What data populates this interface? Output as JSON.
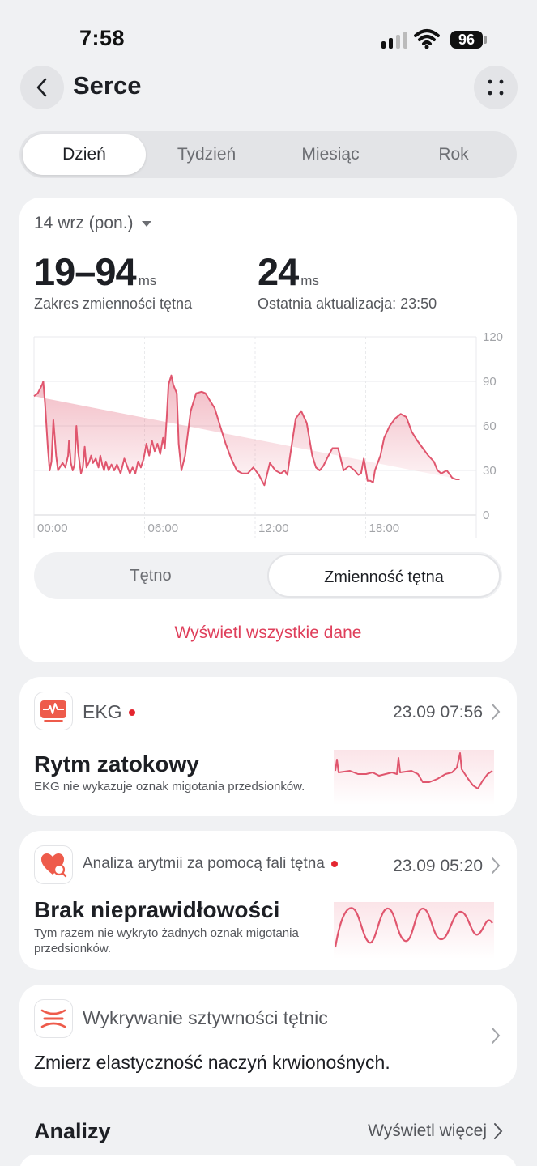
{
  "status_bar": {
    "time": "7:58",
    "battery": "96"
  },
  "header": {
    "title": "Serce"
  },
  "period_tabs": [
    {
      "label": "Dzień",
      "active": true
    },
    {
      "label": "Tydzień",
      "active": false
    },
    {
      "label": "Miesiąc",
      "active": false
    },
    {
      "label": "Rok",
      "active": false
    }
  ],
  "summary": {
    "date": "14 wrz (pon.)",
    "range_value": "19–94",
    "range_unit": "ms",
    "range_label": "Zakres zmienności tętna",
    "last_value": "24",
    "last_unit": "ms",
    "last_label": "Ostatnia aktualizacja: 23:50"
  },
  "chart_data": {
    "type": "area",
    "x_ticks": [
      "00:00",
      "06:00",
      "12:00",
      "18:00"
    ],
    "y_ticks": [
      120,
      90,
      60,
      30,
      0
    ],
    "ylim": [
      0,
      120
    ],
    "xlim": [
      0,
      24
    ],
    "series_color": "#e0566e",
    "x": [
      0.0,
      0.2,
      0.45,
      0.5,
      0.6,
      0.75,
      0.85,
      0.95,
      1.05,
      1.2,
      1.3,
      1.4,
      1.55,
      1.7,
      1.85,
      1.9,
      2.0,
      2.1,
      2.2,
      2.3,
      2.4,
      2.55,
      2.65,
      2.75,
      2.85,
      3.0,
      3.1,
      3.2,
      3.35,
      3.5,
      3.6,
      3.7,
      3.8,
      3.9,
      4.05,
      4.2,
      4.35,
      4.5,
      4.7,
      4.9,
      5.05,
      5.2,
      5.35,
      5.5,
      5.65,
      5.8,
      5.95,
      6.1,
      6.25,
      6.4,
      6.55,
      6.7,
      6.85,
      7.0,
      7.1,
      7.2,
      7.3,
      7.45,
      7.55,
      7.65,
      7.75,
      7.85,
      8.0,
      8.2,
      8.5,
      8.8,
      9.1,
      9.3,
      9.5,
      9.8,
      10.1,
      10.4,
      10.7,
      11.0,
      11.3,
      11.6,
      11.9,
      12.2,
      12.5,
      12.8,
      13.1,
      13.4,
      13.6,
      13.75,
      13.9,
      14.2,
      14.5,
      14.8,
      15.1,
      15.3,
      15.5,
      15.7,
      15.9,
      16.2,
      16.5,
      16.8,
      17.1,
      17.4,
      17.6,
      17.75,
      17.9,
      18.1,
      18.25,
      18.4,
      18.5,
      18.65,
      18.8,
      19.0,
      19.3,
      19.6,
      19.9,
      20.2,
      20.5,
      20.8,
      21.1,
      21.4,
      21.7,
      21.9,
      22.1,
      22.4,
      22.7,
      22.9,
      23.1,
      23.3,
      23.4,
      23.45,
      23.6
    ],
    "values": [
      80,
      82,
      88,
      90,
      75,
      45,
      30,
      36,
      64,
      40,
      30,
      32,
      35,
      32,
      40,
      50,
      35,
      30,
      34,
      60,
      42,
      28,
      32,
      46,
      32,
      36,
      40,
      35,
      38,
      32,
      40,
      34,
      30,
      36,
      30,
      34,
      30,
      34,
      28,
      38,
      33,
      28,
      32,
      28,
      36,
      32,
      38,
      48,
      40,
      50,
      43,
      48,
      41,
      52,
      45,
      65,
      88,
      94,
      88,
      85,
      82,
      48,
      30,
      40,
      70,
      82,
      83,
      82,
      78,
      72,
      60,
      48,
      38,
      30,
      28,
      28,
      32,
      27,
      20,
      35,
      30,
      28,
      30,
      27,
      40,
      65,
      70,
      62,
      40,
      32,
      30,
      33,
      38,
      45,
      45,
      30,
      33,
      30,
      27,
      28,
      38,
      23,
      23,
      22,
      30,
      35,
      40,
      52,
      60,
      65,
      68,
      66,
      56,
      50,
      45,
      40,
      36,
      30,
      28,
      30,
      25,
      24,
      24
    ],
    "title": "",
    "xlabel": "",
    "ylabel": "",
    "grid": true
  },
  "chart_toggle": {
    "left": "Tętno",
    "right": "Zmienność tętna",
    "active": "right"
  },
  "view_all": "Wyświetl wszystkie dane",
  "ekg_card": {
    "name": "EKG",
    "date": "23.09 07:56",
    "title": "Rytm zatokowy",
    "description": "EKG nie wykazuje oznak migotania przedsionków."
  },
  "arrhythmia_card": {
    "name": "Analiza arytmii za pomocą fali tętna",
    "date": "23.09 05:20",
    "title": "Brak nieprawidłowości",
    "description_line1": "Tym razem nie wykryto żadnych oznak migotania",
    "description_line2": "przedsionków."
  },
  "stiffness_card": {
    "name": "Wykrywanie sztywności tętnic",
    "description": "Zmierz elastyczność naczyń krwionośnych."
  },
  "analyses": {
    "title": "Analizy",
    "more": "Wyświetl więcej"
  },
  "colors": {
    "accent": "#df3f5b",
    "background": "#f0f1f3",
    "card": "#ffffff"
  },
  "icons": [
    "back-icon",
    "more-icon",
    "ekg-icon",
    "heart-search-icon",
    "arterial-icon",
    "chevron-right-icon"
  ]
}
